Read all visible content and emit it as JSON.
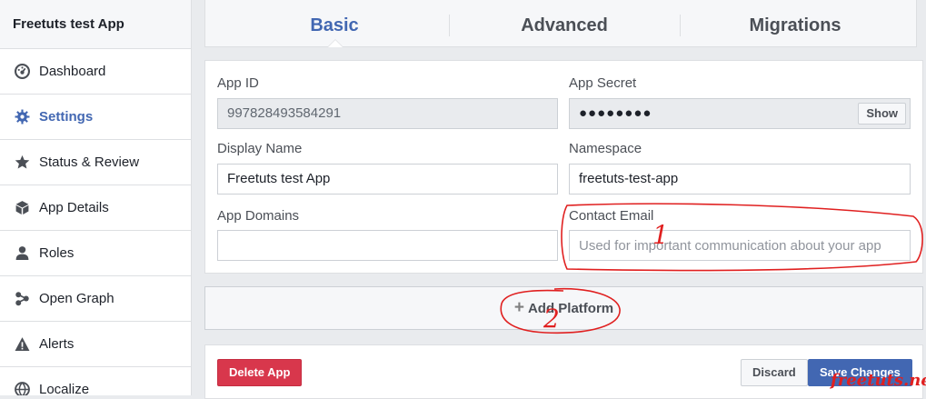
{
  "sidebar": {
    "app_name": "Freetuts test App",
    "items": [
      {
        "label": "Dashboard",
        "icon": "dashboard-icon"
      },
      {
        "label": "Settings",
        "icon": "gear-icon",
        "active": true
      },
      {
        "label": "Status & Review",
        "icon": "star-icon"
      },
      {
        "label": "App Details",
        "icon": "cube-icon"
      },
      {
        "label": "Roles",
        "icon": "person-icon"
      },
      {
        "label": "Open Graph",
        "icon": "graph-icon"
      },
      {
        "label": "Alerts",
        "icon": "warning-icon"
      },
      {
        "label": "Localize",
        "icon": "globe-icon"
      }
    ]
  },
  "tabs": [
    {
      "label": "Basic",
      "active": true
    },
    {
      "label": "Advanced"
    },
    {
      "label": "Migrations"
    }
  ],
  "form": {
    "app_id": {
      "label": "App ID",
      "value": "997828493584291"
    },
    "app_secret": {
      "label": "App Secret",
      "value": "●●●●●●●●",
      "show_label": "Show"
    },
    "display_name": {
      "label": "Display Name",
      "value": "Freetuts test App"
    },
    "namespace": {
      "label": "Namespace",
      "value": "freetuts-test-app"
    },
    "app_domains": {
      "label": "App Domains",
      "value": ""
    },
    "contact_email": {
      "label": "Contact Email",
      "placeholder": "Used for important communication about your app"
    }
  },
  "platform": {
    "label": "Add Platform",
    "plus": "+"
  },
  "footer": {
    "delete_label": "Delete App",
    "discard_label": "Discard",
    "save_label": "Save Changes"
  },
  "annotations": {
    "mark_1": "1",
    "mark_2": "2"
  },
  "watermark": "freetuts.net",
  "colors": {
    "accent": "#4267b2",
    "danger": "#d8374c",
    "annotation": "#e02020"
  }
}
